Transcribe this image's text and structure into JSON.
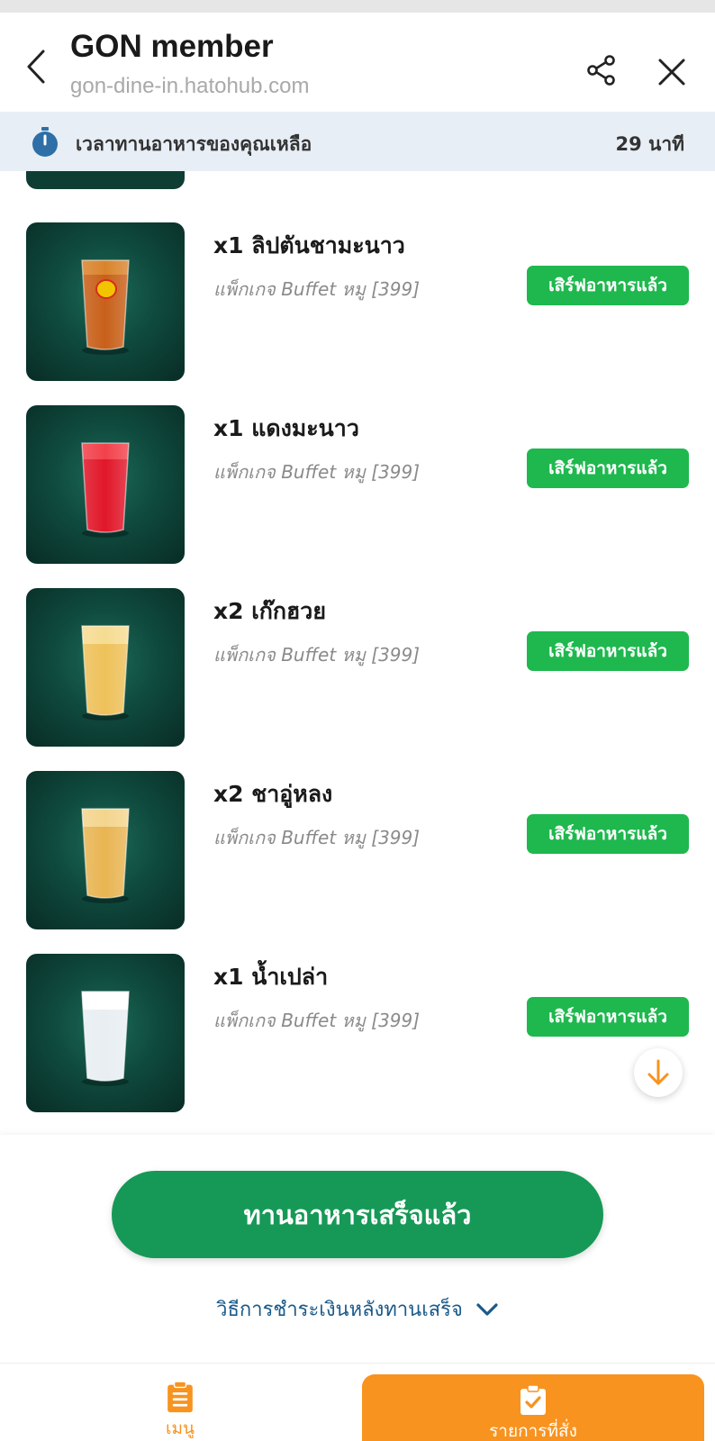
{
  "header": {
    "title": "GON member",
    "url": "gon-dine-in.hatohub.com"
  },
  "timer": {
    "label": "เวลาทานอาหารของคุณเหลือ",
    "value": "29 นาที"
  },
  "orders": [
    {
      "name": "x1 ลิปตันชามะนาว",
      "package": "แพ็กเกจ Buffet หมู [399]",
      "status": "เสิร์ฟอาหารแล้ว",
      "drink_color": "#c8601a",
      "drink_top": "#d9842c"
    },
    {
      "name": "x1 แดงมะนาว",
      "package": "แพ็กเกจ Buffet หมู [399]",
      "status": "เสิร์ฟอาหารแล้ว",
      "drink_color": "#e0172a",
      "drink_top": "#f2414b"
    },
    {
      "name": "x2 เก๊กฮวย",
      "package": "แพ็กเกจ Buffet หมู [399]",
      "status": "เสิร์ฟอาหารแล้ว",
      "drink_color": "#eec15a",
      "drink_top": "#f6dc92"
    },
    {
      "name": "x2 ชาอู่หลง",
      "package": "แพ็กเกจ Buffet หมู [399]",
      "status": "เสิร์ฟอาหารแล้ว",
      "drink_color": "#e9b553",
      "drink_top": "#f4d58e"
    },
    {
      "name": "x1 น้ำเปล่า",
      "package": "แพ็กเกจ Buffet หมู [399]",
      "status": "เสิร์ฟอาหารแล้ว",
      "drink_color": "#e8eef2",
      "drink_top": "#ffffff"
    }
  ],
  "actions": {
    "finish_label": "ทานอาหารเสร็จแล้ว",
    "payment_label": "วิธีการชำระเงินหลังทานเสร็จ"
  },
  "nav": {
    "menu_label": "เมนู",
    "orders_label": "รายการที่สั่ง"
  },
  "colors": {
    "accent_green": "#169856",
    "badge_green": "#1eb84f",
    "accent_orange": "#f7931e",
    "link_blue": "#1a5a8a"
  },
  "icons": {
    "back": "chevron-left-icon",
    "share": "share-icon",
    "close": "close-icon",
    "timer": "stopwatch-icon",
    "scroll_down": "arrow-down-icon",
    "payment_toggle": "chevron-down-icon",
    "menu": "clipboard-list-icon",
    "orders": "clipboard-check-icon"
  }
}
